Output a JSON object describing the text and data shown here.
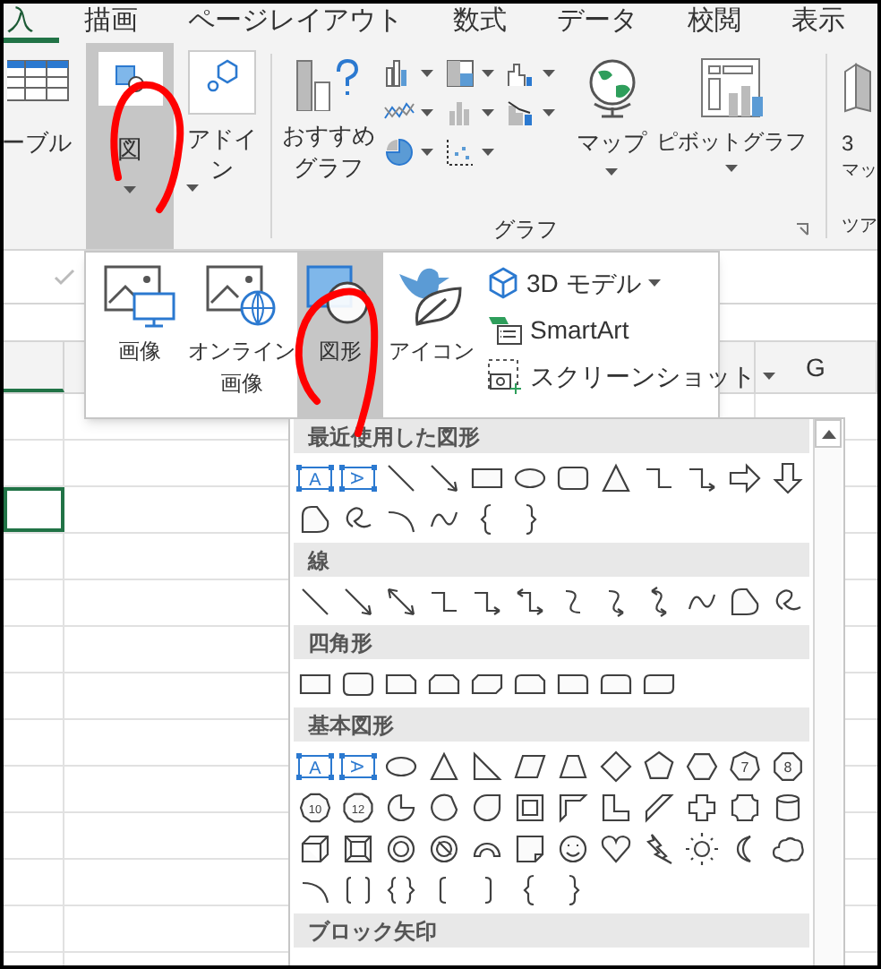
{
  "tabs": [
    {
      "label": "入",
      "selected": true
    },
    {
      "label": "描画",
      "selected": false
    },
    {
      "label": "ページレイアウト",
      "selected": false
    },
    {
      "label": "数式",
      "selected": false
    },
    {
      "label": "データ",
      "selected": false
    },
    {
      "label": "校閲",
      "selected": false
    },
    {
      "label": "表示",
      "selected": false
    }
  ],
  "ribbon": {
    "table_button": {
      "label": "ーブル"
    },
    "picture_button": {
      "label": "図",
      "selected": true
    },
    "addin_button": {
      "label": "アドイン"
    },
    "chart_group": {
      "recommended": {
        "label": "おすすめグラフ"
      },
      "map": {
        "label": "マップ"
      },
      "pivot": {
        "label": "ピボットグラフ"
      },
      "title": "グラフ"
    },
    "map3d": {
      "label_1": "3",
      "label_2": "マッ"
    },
    "tour_group_title": "ツア"
  },
  "sheet": {
    "column_header": "G"
  },
  "picture_menu": {
    "items": [
      {
        "label": "画像",
        "selected": false,
        "kind": "image"
      },
      {
        "label": "オンライン画像",
        "selected": false,
        "kind": "online"
      },
      {
        "label": "図形",
        "selected": true,
        "kind": "shapes"
      },
      {
        "label": "アイコン",
        "selected": false,
        "kind": "icons"
      }
    ],
    "small_items": [
      {
        "label": "3D モデル",
        "kind": "model",
        "has_menu": true
      },
      {
        "label": "SmartArt",
        "kind": "smartart",
        "has_menu": false
      },
      {
        "label": "スクリーンショット",
        "kind": "screenshot",
        "has_menu": true
      }
    ]
  },
  "shape_gallery": {
    "sections": [
      {
        "title": "最近使用した図形",
        "shapes": [
          {
            "kind": "text-box",
            "label": "A"
          },
          {
            "kind": "vertical-text-box",
            "label": "A"
          },
          {
            "kind": "line"
          },
          {
            "kind": "arrow"
          },
          {
            "kind": "rectangle"
          },
          {
            "kind": "oval"
          },
          {
            "kind": "rounded-rectangle"
          },
          {
            "kind": "triangle"
          },
          {
            "kind": "elbow"
          },
          {
            "kind": "elbow-arrow"
          },
          {
            "kind": "right-block-arrow"
          },
          {
            "kind": "down-block-arrow"
          },
          {
            "kind": "freeform"
          },
          {
            "kind": "scribble"
          },
          {
            "kind": "arc"
          },
          {
            "kind": "curve"
          },
          {
            "kind": "left-brace"
          },
          {
            "kind": "right-brace"
          }
        ]
      },
      {
        "title": "線",
        "shapes": [
          {
            "kind": "line"
          },
          {
            "kind": "arrow"
          },
          {
            "kind": "double-arrow"
          },
          {
            "kind": "elbow"
          },
          {
            "kind": "elbow-arrow"
          },
          {
            "kind": "elbow-double-arrow"
          },
          {
            "kind": "curved-connector"
          },
          {
            "kind": "curved-connector-arrow"
          },
          {
            "kind": "curved-double-arrow"
          },
          {
            "kind": "curve"
          },
          {
            "kind": "freeform"
          },
          {
            "kind": "scribble"
          }
        ]
      },
      {
        "title": "四角形",
        "shapes": [
          {
            "kind": "rectangle"
          },
          {
            "kind": "rounded-rectangle"
          },
          {
            "kind": "snip-corner-rectangle"
          },
          {
            "kind": "snip-same-side-rectangle"
          },
          {
            "kind": "snip-diagonal-rectangle"
          },
          {
            "kind": "snip-round-rectangle"
          },
          {
            "kind": "round-corner-rectangle"
          },
          {
            "kind": "round-same-side-rectangle"
          },
          {
            "kind": "round-diagonal-rectangle"
          }
        ]
      },
      {
        "title": "基本図形",
        "shapes": [
          {
            "kind": "text-box",
            "label": "A"
          },
          {
            "kind": "vertical-text-box",
            "label": "A"
          },
          {
            "kind": "oval"
          },
          {
            "kind": "triangle"
          },
          {
            "kind": "right-triangle"
          },
          {
            "kind": "parallelogram"
          },
          {
            "kind": "trapezoid"
          },
          {
            "kind": "diamond"
          },
          {
            "kind": "pentagon"
          },
          {
            "kind": "hexagon"
          },
          {
            "kind": "heptagon",
            "label": "7"
          },
          {
            "kind": "octagon",
            "label": "8"
          },
          {
            "kind": "decagon",
            "label": "10"
          },
          {
            "kind": "dodecagon",
            "label": "12"
          },
          {
            "kind": "pie"
          },
          {
            "kind": "chord"
          },
          {
            "kind": "teardrop"
          },
          {
            "kind": "frame"
          },
          {
            "kind": "half-frame"
          },
          {
            "kind": "l-shape"
          },
          {
            "kind": "diagonal-stripe"
          },
          {
            "kind": "cross"
          },
          {
            "kind": "plaque"
          },
          {
            "kind": "can"
          },
          {
            "kind": "cube"
          },
          {
            "kind": "bevel"
          },
          {
            "kind": "donut"
          },
          {
            "kind": "no-symbol"
          },
          {
            "kind": "block-arc"
          },
          {
            "kind": "folded-corner"
          },
          {
            "kind": "smiley"
          },
          {
            "kind": "heart"
          },
          {
            "kind": "lightning"
          },
          {
            "kind": "sun"
          },
          {
            "kind": "moon"
          },
          {
            "kind": "cloud"
          },
          {
            "kind": "arc"
          },
          {
            "kind": "bracket-pair"
          },
          {
            "kind": "brace-pair"
          },
          {
            "kind": "left-bracket"
          },
          {
            "kind": "right-bracket"
          },
          {
            "kind": "left-brace"
          },
          {
            "kind": "right-brace"
          }
        ]
      },
      {
        "title": "ブロック矢印"
      }
    ]
  }
}
